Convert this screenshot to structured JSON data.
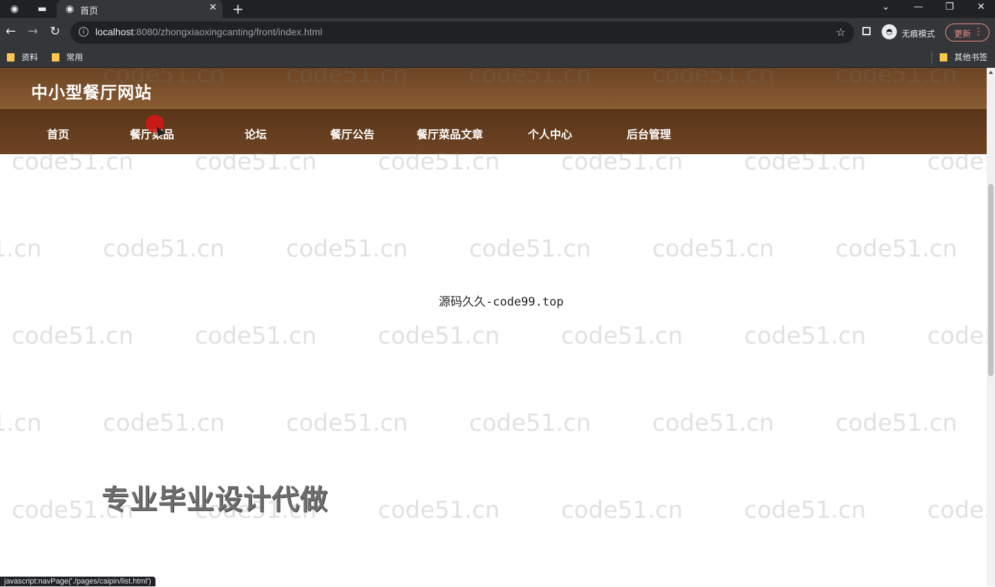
{
  "browser": {
    "tab_title": "首页",
    "url_host": "localhost",
    "url_rest": ":8080/zhongxiaoxingcanting/front/index.html",
    "incognito_label": "无痕模式",
    "update_label": "更新",
    "bookmarks": [
      "资料",
      "常用"
    ],
    "other_bookmarks": "其他书签",
    "status_url": "javascript:navPage('./pages/caipin/list.html')"
  },
  "site": {
    "title": "中小型餐厅网站",
    "nav": [
      "首页",
      "餐厅菜品",
      "论坛",
      "餐厅公告",
      "餐厅菜品文章",
      "个人中心",
      "后台管理"
    ]
  },
  "content": {
    "center_note": "源码久久-code99.top",
    "promo_text": "专业毕业设计代做"
  },
  "watermark_text": "code51.cn",
  "colors": {
    "header_brown": "#7a5029",
    "nav_brown": "#633d1e",
    "cursor_red": "#dc1414"
  }
}
